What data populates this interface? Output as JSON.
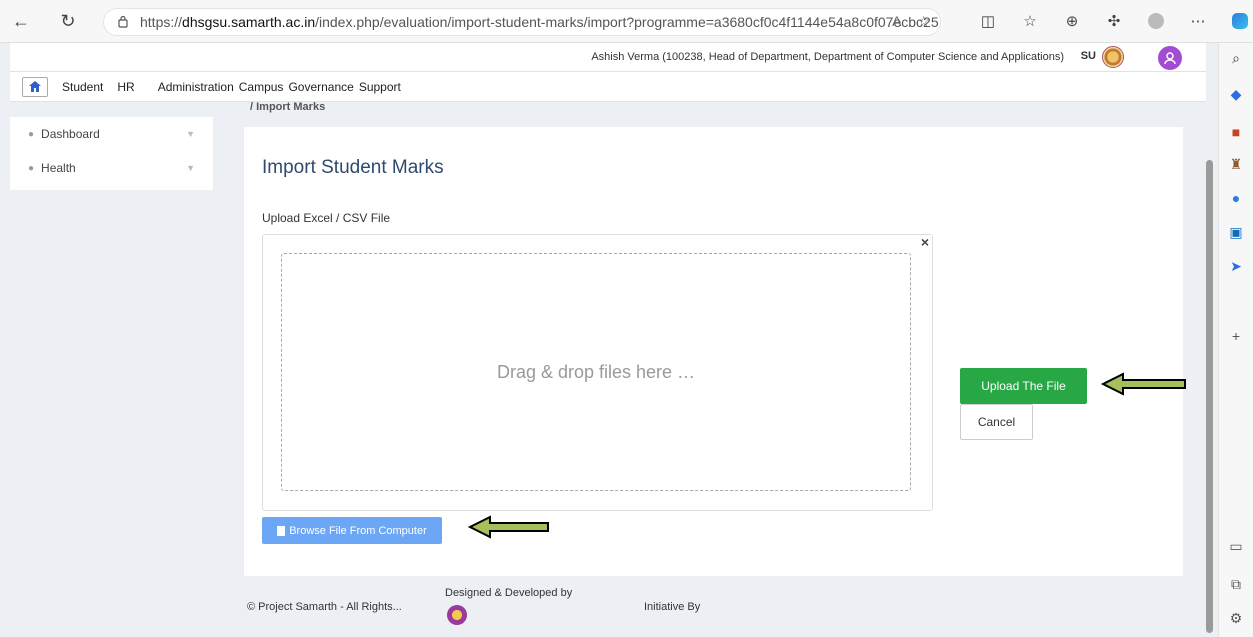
{
  "browser": {
    "url_prefix": "https://",
    "url_host": "dhsgsu.samarth.ac.in",
    "url_path": "/index.php/evaluation/import-student-marks/import?programme=a3680cf0c4f1144e54a8c0f07ecbc25..."
  },
  "header": {
    "user_info": "Ashish Verma (100238, Head of Department, Department of Computer Science and Applications)",
    "short_code": "SU"
  },
  "menu": {
    "items": [
      "Student",
      "HR",
      "Administration",
      "Campus",
      "Governance",
      "Support"
    ]
  },
  "breadcrumb": "/ Import Marks",
  "sidebar": {
    "items": [
      {
        "label": "Dashboard"
      },
      {
        "label": "Health"
      }
    ]
  },
  "main": {
    "title": "Import Student Marks",
    "upload_label": "Upload Excel / CSV File",
    "close_symbol": "×",
    "drop_text": "Drag & drop files here …",
    "upload_button": "Upload The File",
    "cancel_button": "Cancel",
    "browse_button": "Browse File From Computer"
  },
  "footer": {
    "copyright": "© Project Samarth - All Rights...",
    "designed_by": "Designed & Developed by",
    "initiative_by": "Initiative By"
  },
  "colors": {
    "upload_button": "#28a745",
    "browse_button": "#6ba7f5",
    "arrow_fill": "#a5bf5b",
    "title": "#2f4a6e"
  }
}
